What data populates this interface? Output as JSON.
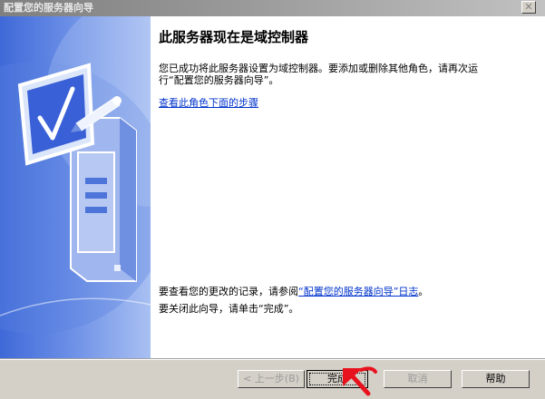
{
  "window": {
    "title": "配置您的服务器向导",
    "close_glyph": "✕"
  },
  "content": {
    "heading": "此服务器现在是域控制器",
    "description": "您已成功将此服务器设置为域控制器。要添加或删除其他角色，请再次运行“配置您的服务器向导”。",
    "steps_link": "查看此角色下面的步骤",
    "log_prefix": "要查看您的更改的记录，请参阅",
    "log_link": "“配置您的服务器向导”日志",
    "log_suffix": "。",
    "close_instruction": "要关闭此向导，请单击“完成”。"
  },
  "buttons": {
    "back": "< 上一步(B)",
    "finish": "完成",
    "cancel": "取消",
    "help": "帮助"
  },
  "colors": {
    "banner_blue": "#3f69d8",
    "link_blue": "#0033cc",
    "annotation_red": "#e8121e"
  },
  "icons": {
    "banner": "server-checkmark-icon",
    "annotation": "red-arrow-annotation"
  }
}
